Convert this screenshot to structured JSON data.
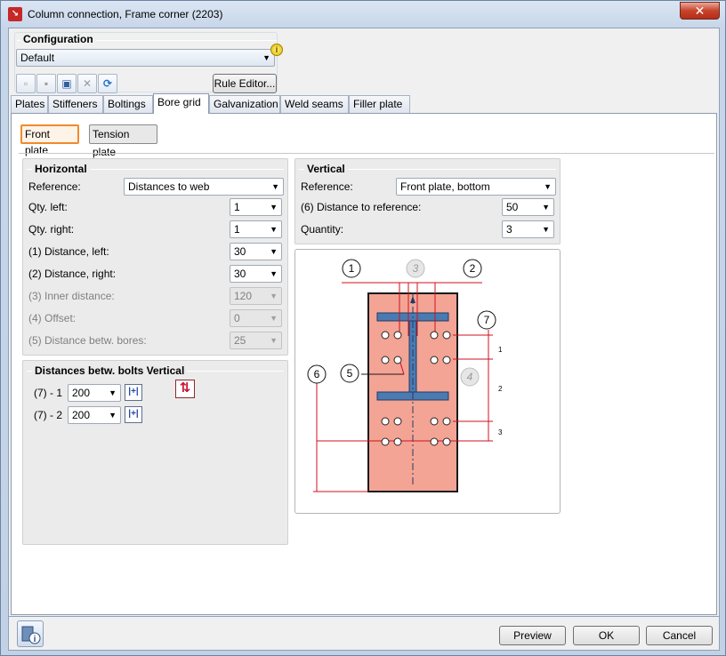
{
  "window": {
    "title": "Column connection, Frame corner (2203)",
    "close_glyph": "✕",
    "icon": "app-logo-icon"
  },
  "configuration": {
    "heading": "Configuration",
    "selected": "Default",
    "rule_editor_label": "Rule Editor...",
    "info_glyph": "i",
    "toolbar_icons": [
      "new-icon",
      "save-icon",
      "save-as-icon",
      "delete-icon",
      "refresh-icon"
    ]
  },
  "tabs": [
    {
      "label": "Plates"
    },
    {
      "label": "Stiffeners"
    },
    {
      "label": "Boltings"
    },
    {
      "label": "Bore grid",
      "active": true
    },
    {
      "label": "Galvanization"
    },
    {
      "label": "Weld seams"
    },
    {
      "label": "Filler plate"
    }
  ],
  "subtabs": {
    "front_plate": "Front plate",
    "tension_plate": "Tension plate"
  },
  "horizontal": {
    "heading": "Horizontal",
    "reference_label": "Reference:",
    "reference_value": "Distances to web",
    "qty_left_label": "Qty. left:",
    "qty_left_value": "1",
    "qty_right_label": "Qty. right:",
    "qty_right_value": "1",
    "dist_left_label": "(1) Distance, left:",
    "dist_left_value": "30",
    "dist_right_label": "(2) Distance, right:",
    "dist_right_value": "30",
    "inner_label": "(3) Inner distance:",
    "inner_value": "120",
    "offset_label": "(4) Offset:",
    "offset_value": "0",
    "bores_label": "(5) Distance betw. bores:",
    "bores_value": "25"
  },
  "vertical": {
    "heading": "Vertical",
    "reference_label": "Reference:",
    "reference_value": "Front plate, bottom",
    "dist_ref_label": "(6) Distance to reference:",
    "dist_ref_value": "50",
    "quantity_label": "Quantity:",
    "quantity_value": "3"
  },
  "bolts_vertical": {
    "heading": "Distances betw. bolts Vertical",
    "rows": [
      {
        "label": "(7) - 1",
        "value": "200"
      },
      {
        "label": "(7) - 2",
        "value": "200"
      }
    ],
    "swap_glyph": "⇅",
    "spacing_glyph": "|+|"
  },
  "drawing": {
    "callouts": [
      "1",
      "3",
      "2",
      "7",
      "5",
      "4",
      "6"
    ],
    "row_labels": [
      "1",
      "2",
      "3"
    ],
    "colors": {
      "plate": "#f4a494",
      "profile": "#4a7ab0",
      "dimension": "#d0101c",
      "disabled_callout": "#bdbdbd"
    }
  },
  "footer": {
    "preview": "Preview",
    "ok": "OK",
    "cancel": "Cancel"
  }
}
